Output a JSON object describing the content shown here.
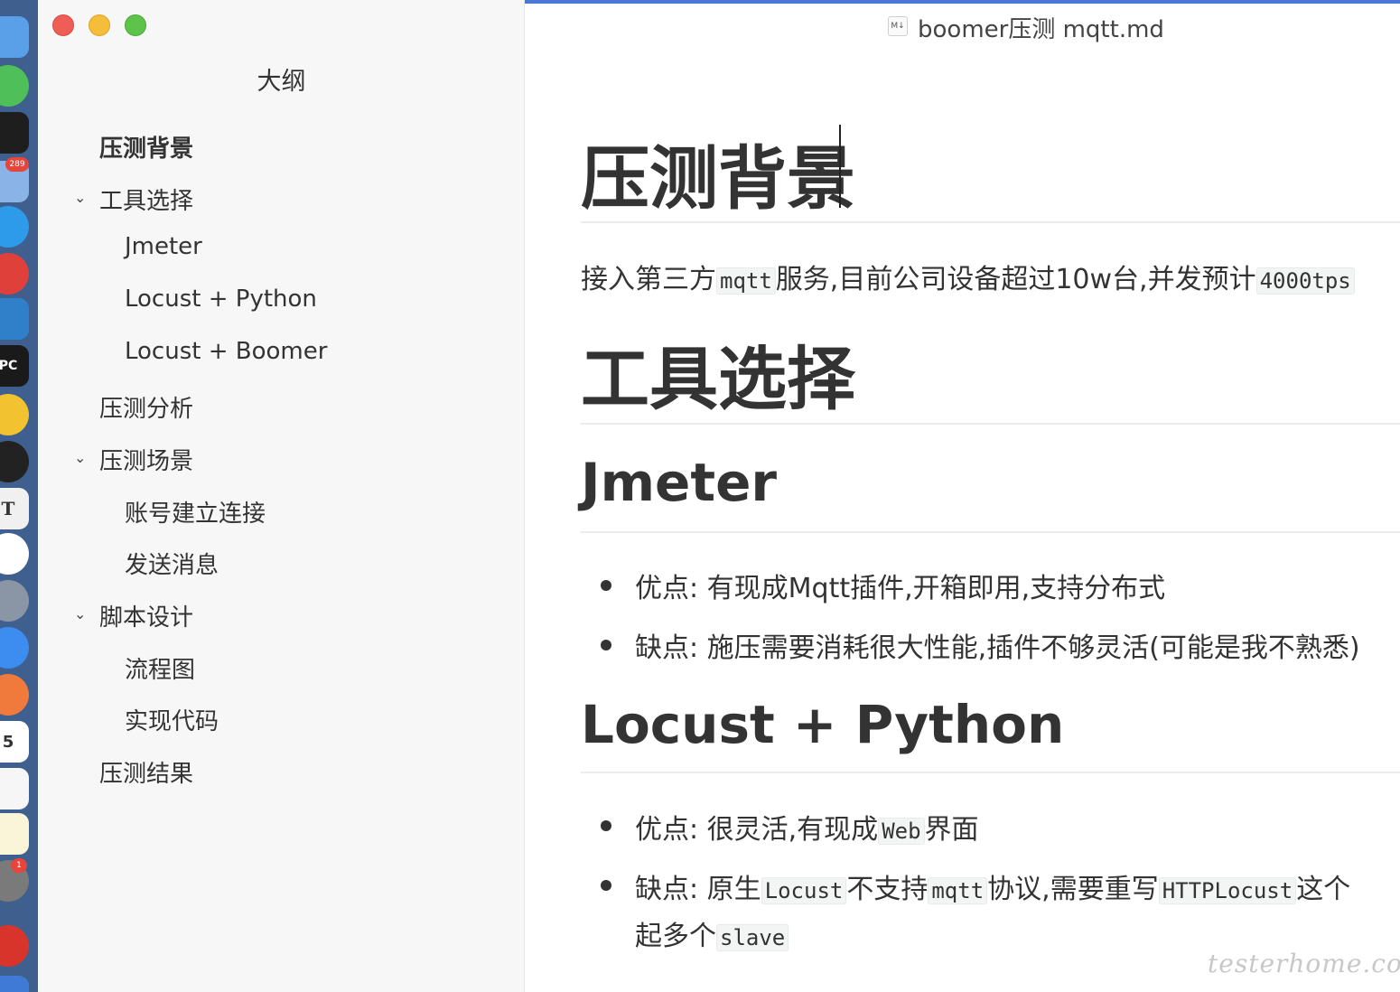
{
  "dock": {
    "badges": [
      "289",
      "1"
    ],
    "calendar_day": "5",
    "pc_label": "PC",
    "t_label": "T"
  },
  "window": {
    "filename": "boomer压测 mqtt.md",
    "file_icon_label": "M↓"
  },
  "sidebar": {
    "title": "大纲",
    "items": [
      {
        "label": "压测背景",
        "level": 1,
        "active": true
      },
      {
        "label": "工具选择",
        "level": 1,
        "expanded": true
      },
      {
        "label": "Jmeter",
        "level": 2
      },
      {
        "label": "Locust + Python",
        "level": 2
      },
      {
        "label": "Locust + Boomer",
        "level": 2
      },
      {
        "label": "压测分析",
        "level": 1
      },
      {
        "label": "压测场景",
        "level": 1,
        "expanded": true
      },
      {
        "label": "账号建立连接",
        "level": 2
      },
      {
        "label": "发送消息",
        "level": 2
      },
      {
        "label": "脚本设计",
        "level": 1,
        "expanded": true
      },
      {
        "label": "流程图",
        "level": 2
      },
      {
        "label": "实现代码",
        "level": 2
      },
      {
        "label": "压测结果",
        "level": 1
      }
    ]
  },
  "document": {
    "h1_background": "压测背景",
    "intro": {
      "t1": "接入第三方",
      "c1": "mqtt",
      "t2": "服务,目前公司设备超过10w台,并发预计",
      "c2": "4000tps"
    },
    "h1_tools": "工具选择",
    "h2_jmeter": "Jmeter",
    "jmeter_pros": "优点: 有现成Mqtt插件,开箱即用,支持分布式",
    "jmeter_cons": "缺点: 施压需要消耗很大性能,插件不够灵活(可能是我不熟悉)",
    "h2_locust_python": "Locust + Python",
    "lp_pros": {
      "t1": "优点:  很灵活,有现成",
      "c1": "Web",
      "t2": "界面"
    },
    "lp_cons": {
      "t1": "缺点: 原生",
      "c1": "Locust",
      "t2": "不支持",
      "c2": "mqtt",
      "t3": "协议,需要重写",
      "c3": "HTTPLocust",
      "t4": "这个",
      "line2_t": "起多个",
      "line2_c": "slave"
    },
    "watermark": "testerhome.com"
  }
}
